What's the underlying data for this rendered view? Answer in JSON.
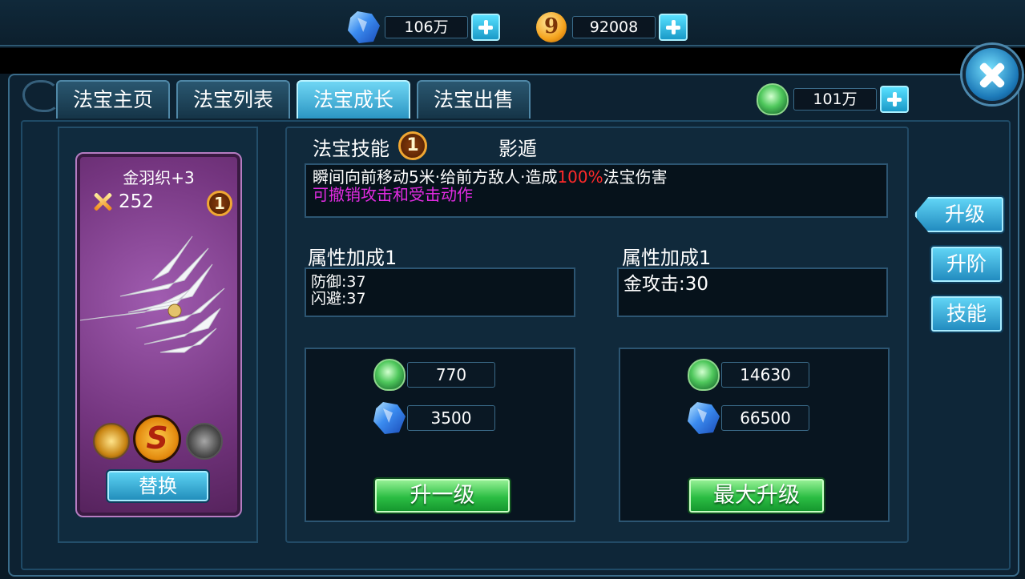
{
  "top_resources": {
    "crystal": "106万",
    "coin": "92008"
  },
  "tabs": [
    "法宝主页",
    "法宝列表",
    "法宝成长",
    "法宝出售"
  ],
  "active_tab": 2,
  "jade_currency": "101万",
  "card": {
    "name": "金羽织+3",
    "power": "252",
    "level_badge": "1",
    "replace_label": "替换"
  },
  "skill": {
    "title": "法宝技能",
    "badge": "1",
    "name": "影遁",
    "desc_part1": "瞬间向前移动5米·给前方敌人·造成",
    "desc_pct": "100%",
    "desc_part2": "法宝伤害",
    "desc_line2": "可撤销攻击和受击动作"
  },
  "attr_left": {
    "title": "属性加成1",
    "line1": "防御:37",
    "line2": "闪避:37"
  },
  "attr_right": {
    "title": "属性加成1",
    "line1": "金攻击:30"
  },
  "cost_left": {
    "jade": "770",
    "crystal": "3500",
    "button": "升一级"
  },
  "cost_right": {
    "jade": "14630",
    "crystal": "66500",
    "button": "最大升级"
  },
  "side_buttons": [
    "升级",
    "升阶",
    "技能"
  ],
  "colors": {
    "accent_cyan": "#2b95c2",
    "highlight_red": "#ff2a2a",
    "highlight_magenta": "#e02be0",
    "card_purple": "#74357f",
    "button_green": "#2bbd43"
  }
}
